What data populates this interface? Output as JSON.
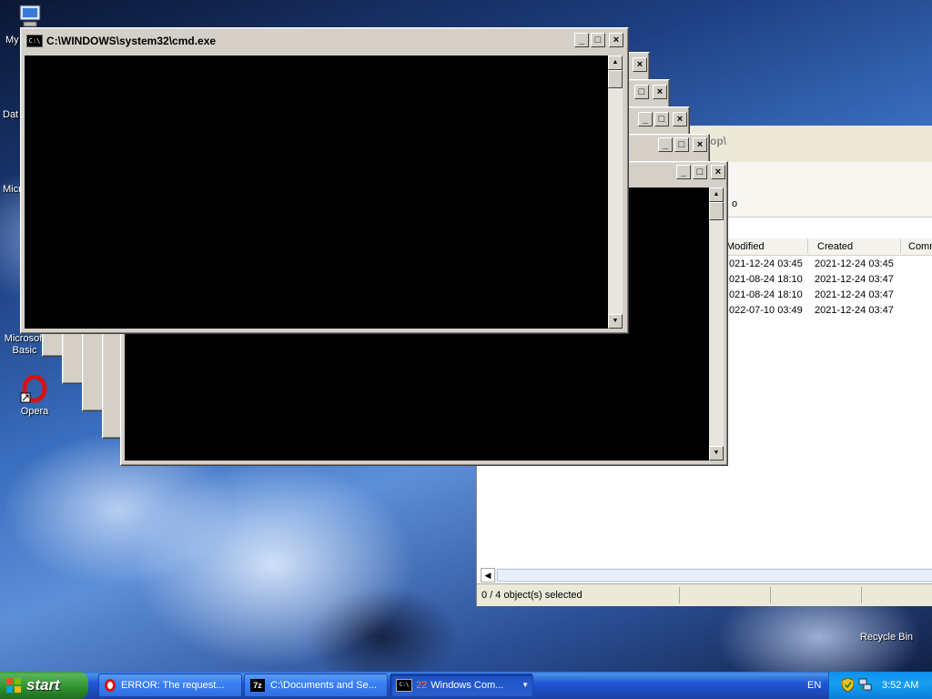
{
  "desktop": {
    "icons": [
      {
        "label": "My",
        "icon": "my-computer-icon"
      },
      {
        "label": "Dat",
        "icon": "data-icon"
      },
      {
        "label": "Micr",
        "icon": "microsoft-icon"
      },
      {
        "label": "Microsoft Basic",
        "icon": "microsoft-basic-icon"
      },
      {
        "label": "Opera",
        "icon": "opera-icon"
      },
      {
        "label": "Recycle Bin",
        "icon": "recycle-bin-icon"
      }
    ]
  },
  "cmd_window": {
    "title": "C:\\WINDOWS\\system32\\cmd.exe",
    "minimize": "_",
    "maximize": "□",
    "close": "×"
  },
  "explorer": {
    "path_fragment": "top\\",
    "sub_fragment": "o",
    "columns": [
      "Modified",
      "Created",
      "Comm"
    ],
    "rows": [
      {
        "modified": "021-12-24 03:45",
        "created": "2021-12-24 03:45"
      },
      {
        "modified": "021-08-24 18:10",
        "created": "2021-12-24 03:47"
      },
      {
        "modified": "021-08-24 18:10",
        "created": "2021-12-24 03:47"
      },
      {
        "modified": "022-07-10 03:49",
        "created": "2021-12-24 03:47"
      }
    ],
    "status": "0 / 4 object(s) selected"
  },
  "taskbar": {
    "start_label": "start",
    "tasks": [
      {
        "label": "ERROR: The request...",
        "icon": "opera-icon"
      },
      {
        "label": "C:\\Documents and Se...",
        "icon": "7zip-icon"
      },
      {
        "label": "Windows Com...",
        "icon": "cmd-icon",
        "count": "22"
      }
    ],
    "language": "EN",
    "clock": "3:52 AM"
  }
}
